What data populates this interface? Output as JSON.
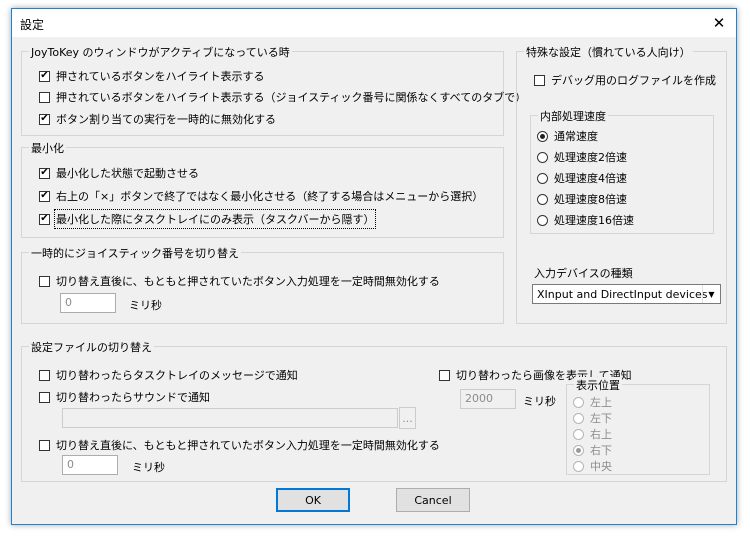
{
  "window": {
    "title": "設定",
    "close_icon": "✕"
  },
  "active_window": {
    "legend": "JoyToKey のウィンドウがアクティブになっている時",
    "items": [
      {
        "label": "押されているボタンをハイライト表示する",
        "checked": true
      },
      {
        "label": "押されているボタンをハイライト表示する（ジョイスティック番号に関係なくすべてのタブで）",
        "checked": false
      },
      {
        "label": "ボタン割り当ての実行を一時的に無効化する",
        "checked": true
      }
    ]
  },
  "minimize": {
    "legend": "最小化",
    "items": [
      {
        "label": "最小化した状態で起動させる",
        "checked": true
      },
      {
        "label": "右上の「×」ボタンで終了ではなく最小化させる（終了する場合はメニューから選択）",
        "checked": true
      },
      {
        "label": "最小化した際にタスクトレイにのみ表示（タスクバーから隠す）",
        "checked": true
      }
    ]
  },
  "temp_switch": {
    "legend": "一時的にジョイスティック番号を切り替え",
    "item": {
      "label": "切り替え直後に、もともと押されていたボタン入力処理を一定時間無効化する",
      "checked": false
    },
    "ms_value": "0",
    "ms_unit": "ミリ秒"
  },
  "special": {
    "legend": "特殊な設定（慣れている人向け）",
    "debug": {
      "label": "デバッグ用のログファイルを作成",
      "checked": false
    },
    "speed": {
      "legend": "内部処理速度",
      "options": [
        {
          "label": "通常速度",
          "selected": true
        },
        {
          "label": "処理速度2倍速",
          "selected": false
        },
        {
          "label": "処理速度4倍速",
          "selected": false
        },
        {
          "label": "処理速度8倍速",
          "selected": false
        },
        {
          "label": "処理速度16倍速",
          "selected": false
        }
      ]
    },
    "device": {
      "label": "入力デバイスの種類",
      "value": "XInput and DirectInput devices",
      "arrow_icon": "▼"
    }
  },
  "config_switch": {
    "legend": "設定ファイルの切り替え",
    "tray_notify": {
      "label": "切り替わったらタスクトレイのメッセージで通知",
      "checked": false
    },
    "sound_notify": {
      "label": "切り替わったらサウンドで通知",
      "checked": false
    },
    "sound_path": "",
    "browse_label": "...",
    "disable_input": {
      "label": "切り替え直後に、もともと押されていたボタン入力処理を一定時間無効化する",
      "checked": false
    },
    "ms_value": "0",
    "ms_unit": "ミリ秒",
    "image_notify": {
      "label": "切り替わったら画像を表示して通知",
      "checked": false
    },
    "image_ms_value": "2000",
    "image_ms_unit": "ミリ秒",
    "position": {
      "legend": "表示位置",
      "options": [
        {
          "label": "左上",
          "selected": false
        },
        {
          "label": "左下",
          "selected": false
        },
        {
          "label": "右上",
          "selected": false
        },
        {
          "label": "右下",
          "selected": true
        },
        {
          "label": "中央",
          "selected": false
        }
      ]
    }
  },
  "buttons": {
    "ok": "OK",
    "cancel": "Cancel"
  },
  "check_mark": "✔"
}
